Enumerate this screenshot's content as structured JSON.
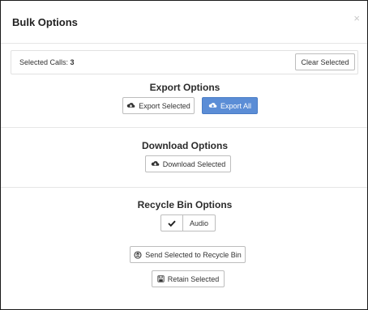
{
  "modal": {
    "title": "Bulk Options",
    "close_icon": "close-icon"
  },
  "selected": {
    "label": "Selected Calls:",
    "count": "3",
    "clear_button": "Clear Selected"
  },
  "export": {
    "title": "Export Options",
    "export_selected": "Export Selected",
    "export_all": "Export All",
    "icon": "cloud-download-icon"
  },
  "download": {
    "title": "Download Options",
    "download_selected": "Download Selected",
    "icon": "cloud-download-icon"
  },
  "recycle": {
    "title": "Recycle Bin Options",
    "audio_label": "Audio",
    "audio_checked": true,
    "send_button": "Send Selected to Recycle Bin",
    "retain_button": "Retain Selected",
    "send_icon": "recycle-icon",
    "retain_icon": "save-icon"
  },
  "colors": {
    "primary": "#5b8dd6",
    "border": "#bdbdbd",
    "divider": "#e6e6e6"
  }
}
